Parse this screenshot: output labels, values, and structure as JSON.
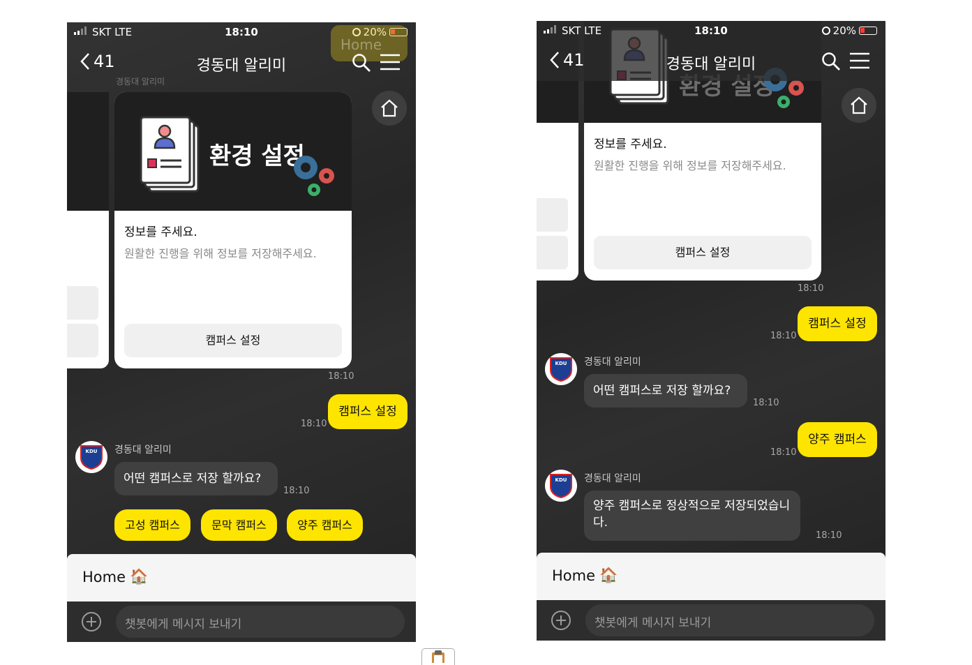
{
  "status_bar": {
    "carrier": "SKT  LTE",
    "time": "18:10",
    "battery": "20%"
  },
  "nav": {
    "back_count": "41",
    "title": "경동대 알리미"
  },
  "settings_card": {
    "banner_text": "환경 설정",
    "heading": "정보를 주세요.",
    "description": "원활한 진행을 위해 정보를 저장해주세요.",
    "button_label": "캠퍼스 설정",
    "timestamp": "18:10"
  },
  "ghost_text": {
    "home": "Home",
    "bot_small": "경동대 알리미"
  },
  "chat": {
    "user_msg_1": {
      "text": "캠퍼스 설정",
      "time": "18:10"
    },
    "bot_name": "경동대 알리미",
    "bot_msg_1": {
      "text": "어떤 캠퍼스로 저장 할까요?",
      "time": "18:10"
    },
    "quick_replies": [
      "고성 캠퍼스",
      "문막 캠퍼스",
      "양주 캠퍼스"
    ],
    "user_msg_2": {
      "text": "양주 캠퍼스",
      "time": "18:10"
    },
    "bot_msg_2": {
      "line1": "양주 캠퍼스로 정상적으로 저장되었습니",
      "line2": "다.",
      "time": "18:10"
    }
  },
  "logo_text": "KDU",
  "home_bar": {
    "label": "Home",
    "emoji": "🏠"
  },
  "input": {
    "placeholder": "챗봇에게 메시지 보내기"
  },
  "colors": {
    "accent_yellow": "#fee500",
    "background": "#2b2b2b",
    "bot_bubble": "#404040"
  }
}
